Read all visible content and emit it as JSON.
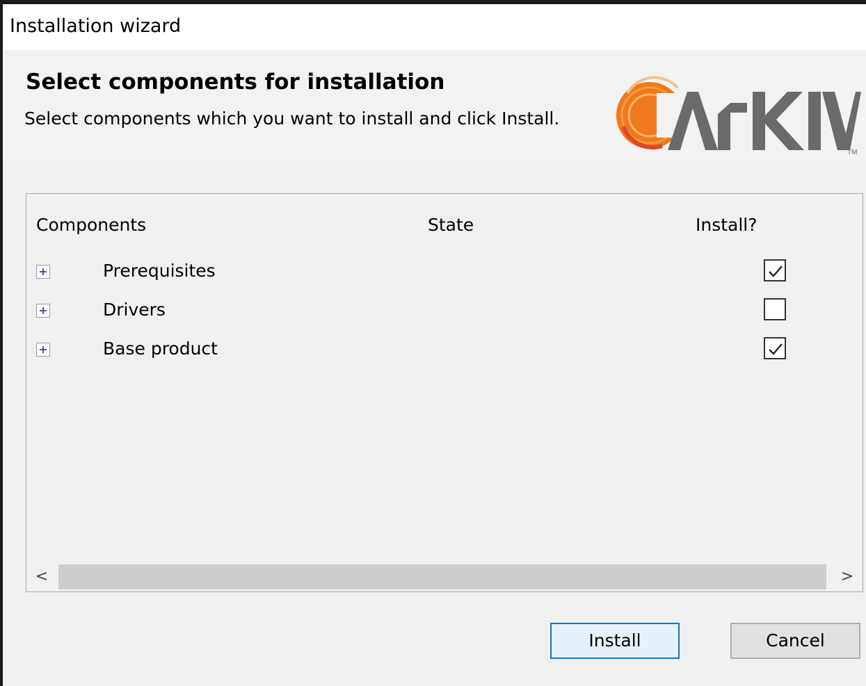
{
  "window": {
    "title": "Installation wizard"
  },
  "header": {
    "title": "Select components for installation",
    "subtitle": "Select components which you want to install and click Install.",
    "logo_text": "ARKIV",
    "logo_tm": "TM",
    "logo_color": "#f07a1e"
  },
  "table": {
    "columns": [
      "Components",
      "State",
      "Install?"
    ],
    "rows": [
      {
        "label": "Prerequisites",
        "state": "",
        "checked": true
      },
      {
        "label": "Drivers",
        "state": "",
        "checked": false
      },
      {
        "label": "Base product",
        "state": "",
        "checked": true
      }
    ],
    "scroll_left": "<",
    "scroll_right": ">"
  },
  "buttons": {
    "install": "Install",
    "cancel": "Cancel"
  },
  "icons": {
    "expand": "plus-box-icon",
    "check": "check-icon"
  }
}
